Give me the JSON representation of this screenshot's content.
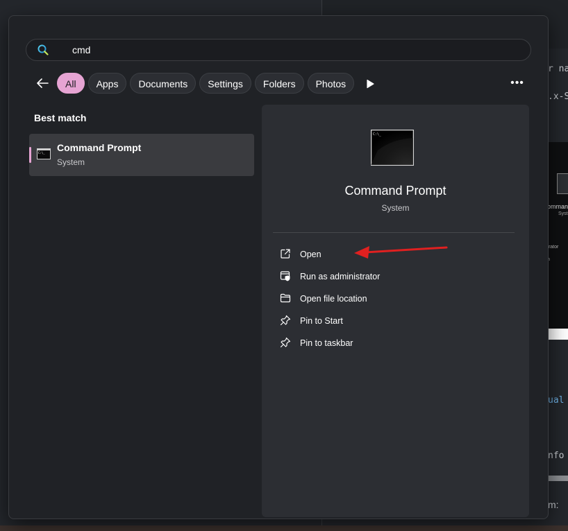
{
  "background": {
    "text_lines": [
      "r nam",
      ".x-Se",
      "ual",
      "nfo",
      "m:"
    ],
    "thumbnail_caption": "ommand",
    "thumbnail_sub": "Syst",
    "thumbnail_item1": "trator",
    "thumbnail_item2": "n"
  },
  "search": {
    "value": "cmd",
    "icon": "search-icon"
  },
  "filters": {
    "back_icon": "back-arrow-icon",
    "chips": [
      "All",
      "Apps",
      "Documents",
      "Settings",
      "Folders",
      "Photos"
    ],
    "active": "All",
    "more_icon": "play-icon",
    "overflow_label": "•••"
  },
  "best_match": {
    "label": "Best match",
    "title": "Command Prompt",
    "subtitle": "System",
    "icon": "terminal-icon"
  },
  "preview": {
    "title": "Command Prompt",
    "subtitle": "System",
    "actions": [
      {
        "label": "Open",
        "icon": "open-external-icon"
      },
      {
        "label": "Run as administrator",
        "icon": "shield-admin-icon"
      },
      {
        "label": "Open file location",
        "icon": "folder-icon"
      },
      {
        "label": "Pin to Start",
        "icon": "pin-icon"
      },
      {
        "label": "Pin to taskbar",
        "icon": "pin-icon"
      }
    ]
  },
  "colors": {
    "accent": "#e6a4d3",
    "annotation_arrow": "#e02020"
  }
}
